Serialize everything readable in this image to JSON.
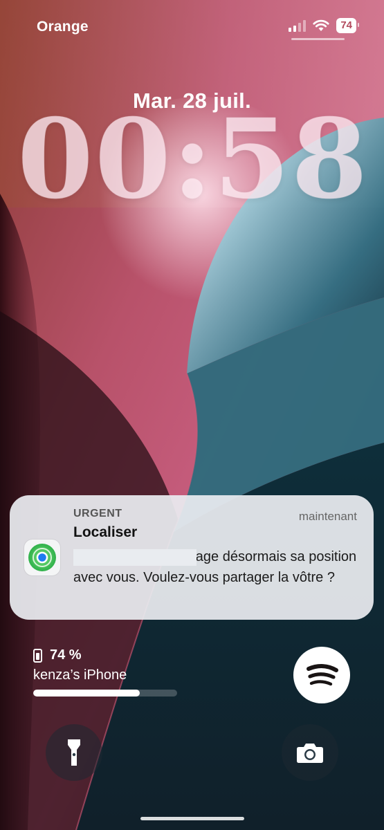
{
  "status_bar": {
    "carrier": "Orange",
    "battery_level": "74"
  },
  "lock_screen": {
    "date": "Mar. 28 juil.",
    "time": "00:58"
  },
  "notification": {
    "priority": "URGENT",
    "timestamp": "maintenant",
    "app_name": "Localiser",
    "body": "Kenza Aissaoui partage désormais sa position avec vous. Voulez-vous partager la vôtre ?",
    "icon": "find-my-icon"
  },
  "battery_widget": {
    "percent_label": "74 %",
    "device_name": "kenza’s iPhone",
    "level": 0.74
  },
  "shortcuts": {
    "left": "flashlight-icon",
    "right": "camera-icon",
    "media_app": "spotify-icon"
  },
  "colors": {
    "notification_bg": "#e9ecf0",
    "findmy_green": "#34c759",
    "spotify_black": "#191414"
  }
}
